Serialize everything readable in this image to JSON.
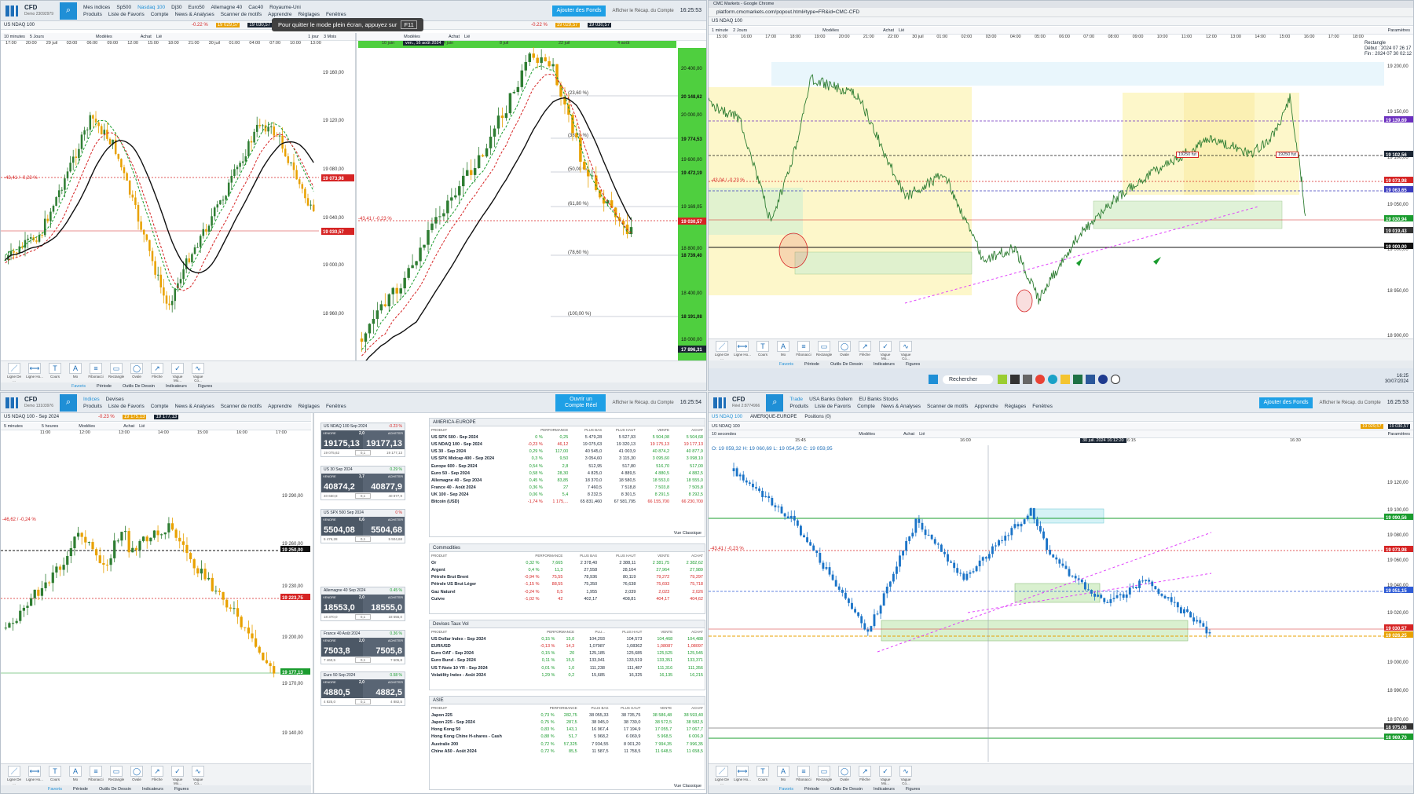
{
  "app": {
    "brand": "CFD",
    "demo_label": "Demo 23092979",
    "demo_label_2": "Demo 13103976",
    "demo_label_3": "Réel 2:8774966",
    "menu": [
      "Produits",
      "Liste de Favoris",
      "Compte",
      "News & Analyses",
      "Scanner de motifs",
      "Apprendre",
      "Réglages",
      "Fenêtres"
    ],
    "cta_funds": "Ajouter des Fonds",
    "cta_real": "Ouvrir un Compte Réel",
    "recap": "Afficher le Récap. du Compte",
    "clock": "16:25:53",
    "clock2": "16:25:54",
    "fullscreen_hint": "Pour quitter le mode plein écran, appuyez sur",
    "fullscreen_key": "F11"
  },
  "q1": {
    "tabs": [
      "Mes indices",
      "Sp500",
      "Nasdaq 100",
      "Dj30",
      "Euro50",
      "Allemagne 40",
      "Cac40",
      "Royaume-Uni"
    ],
    "instrument": "US NDAQ 100",
    "badge": "-0.22 %",
    "badge_sub": "-42.91",
    "sell": "19 029,57",
    "buy": "19 030,57",
    "timeframe_left": "10 minutes",
    "range_left": "5 Jours",
    "timeframe_mid": "1 jour",
    "range_mid": "3 Mois",
    "models": "Modèles",
    "achat": "Achat",
    "lie": "Lié",
    "y_ticks_left": [
      "19 160,00",
      "19 120,00",
      "19 080,00",
      "19 040,00",
      "19 000,00",
      "18 960,00"
    ],
    "tag_left_1": "19 073,98",
    "tag_left_2": "19 030,57",
    "change_label": "-43,41 / -0,23 %",
    "x_ticks_left": [
      "17:00",
      "20:00",
      "29 juil",
      "03:00",
      "06:00",
      "09:00",
      "12:00",
      "15:00",
      "18:00",
      "21:00",
      "30 juil",
      "01:00",
      "04:00",
      "07:00",
      "10:00",
      "13:00"
    ],
    "mid_date": "ven., 16 août 2024",
    "x_ticks_mid": [
      "10 juin",
      "24 juin",
      "8 juil",
      "22 juil",
      "4 août"
    ],
    "y_ticks_mid": [
      "20 400,00",
      "20 148,62",
      "20 000,00",
      "19 774,53",
      "19 600,00",
      "19 472,19",
      "19 169,05",
      "19 030,57",
      "18 800,00",
      "18 739,40",
      "18 400,00",
      "18 191,08",
      "18 000,00",
      "17 896,31"
    ],
    "fibs": [
      "(23,60 %)",
      "(38,20 %)",
      "(50,00 %)",
      "(61,80 %)",
      "(78,60 %)",
      "(100,00 %)"
    ],
    "bottom_tabs": [
      "Favoris",
      "Période",
      "Outils De Dessin",
      "Indicateurs",
      "Figures"
    ]
  },
  "tools": [
    {
      "icon": "line-icon",
      "label": "Ligne De ..."
    },
    {
      "icon": "hline-icon",
      "label": "Ligne Ho..."
    },
    {
      "icon": "price-icon",
      "label": "Cours"
    },
    {
      "icon": "text-icon",
      "label": "Mo"
    },
    {
      "icon": "fibonacci-icon",
      "label": "Fibonacci"
    },
    {
      "icon": "rectangle-icon",
      "label": "Rectangle"
    },
    {
      "icon": "oval-icon",
      "label": "Ovale"
    },
    {
      "icon": "arrow-icon",
      "label": "Flèche"
    },
    {
      "icon": "wave-icon",
      "label": "Vague Mo..."
    },
    {
      "icon": "wave2-icon",
      "label": "Vague Co..."
    }
  ],
  "q2": {
    "browser_title": "CMC Markets - Google Chrome",
    "url": "platform.cmcmarkets.com/popout.html#type=FR&id=CMC-CFD",
    "instrument": "US NDAQ 100",
    "timeframe": "1 minute",
    "range": "2 Jours",
    "params": "Paramètres",
    "info_title": "Rectangle",
    "info_start": "Début : 2024 07 26 17",
    "info_end": "Fin : 2024 07 30 02:12",
    "x_ticks": [
      "15:00",
      "16:00",
      "17:00",
      "18:00",
      "19:00",
      "20:00",
      "21:00",
      "22:00",
      "30 juil",
      "01:00",
      "02:00",
      "03:00",
      "04:00",
      "05:00",
      "06:00",
      "07:00",
      "08:00",
      "09:00",
      "10:00",
      "11:00",
      "12:00",
      "13:00",
      "14:00",
      "15:00",
      "16:00",
      "17:00",
      "18:00"
    ],
    "y_ticks": [
      "19 200,00",
      "19 150,00",
      "19 100,00",
      "19 050,00",
      "19 000,00",
      "18 950,00",
      "18 900,00"
    ],
    "tags": [
      {
        "v": "19 139,69",
        "c": "#6b2fbf"
      },
      {
        "v": "19 102,56",
        "c": "#1a2533"
      },
      {
        "v": "19 073,98",
        "c": "#d62424"
      },
      {
        "v": "19 063,65",
        "c": "#3b3bbf"
      },
      {
        "v": "19 030,94",
        "c": "#1a9c2e"
      },
      {
        "v": "19 019,43",
        "c": "#333333"
      },
      {
        "v": "19 000,00",
        "c": "#111111"
      }
    ],
    "flag1": "19250 fut",
    "flag2": "19250 fut",
    "change_label": "-43,04 / -0,23 %",
    "taskbar_search": "Rechercher",
    "taskbar_time": "16:25",
    "taskbar_date": "30/07/2024"
  },
  "q3": {
    "tabs": [
      "Indices",
      "Devises"
    ],
    "instrument": "US NDAQ 100 - Sep 2024",
    "badge": "-0.23 %",
    "sell": "19 175,13",
    "buy": "19 177,13",
    "timeframe": "5 minutes",
    "range": "5 heures",
    "x_ticks": [
      "11:00",
      "12:00",
      "13:00",
      "14:00",
      "15:00",
      "16:00",
      "17:00"
    ],
    "y_ticks": [
      "19 290,00",
      "19 260,00",
      "19 230,00",
      "19 200,00",
      "19 170,00",
      "19 140,00"
    ],
    "tag_1": "19 250,00",
    "tag_2": "19 223,75",
    "tag_3": "19 177,13",
    "change_label": "-46,62 / -0,24 %"
  },
  "tickets": [
    {
      "name": "US NDAQ 100 Sep 2024",
      "chg": "-0.23 %",
      "sell": "19175,13",
      "buy": "19177,13",
      "spread": "2,0",
      "lo": "19 075,62",
      "qty": "0,1",
      "hi": "19 177,13"
    },
    {
      "name": "US 30 Sep 2024",
      "chg": "0.29 %",
      "sell": "40874,2",
      "buy": "40877,9",
      "spread": "3,7",
      "lo": "40 650,8",
      "qty": "0,1",
      "hi": "40 877,9"
    },
    {
      "name": "US SPX 500 Sep 2024",
      "chg": "0 %",
      "sell": "5504,08",
      "buy": "5504,68",
      "spread": "0,6",
      "lo": "5 476,28",
      "qty": "0,1",
      "hi": "5 504,68"
    },
    {
      "name": "Allemagne 40 Sep 2024",
      "chg": "0.45 %",
      "sell": "18553,0",
      "buy": "18555,0",
      "spread": "2,0",
      "lo": "18 370,0",
      "qty": "0,1",
      "hi": "18 555,0"
    },
    {
      "name": "France 40 Août 2024",
      "chg": "0.36 %",
      "sell": "7503,8",
      "buy": "7505,8",
      "spread": "2,0",
      "lo": "7 460,5",
      "qty": "0,1",
      "hi": "7 505,8"
    },
    {
      "name": "Euro 50 Sep 2024",
      "chg": "0.58 %",
      "sell": "4880,5",
      "buy": "4882,5",
      "spread": "2,0",
      "lo": "4 825,0",
      "qty": "0,1",
      "hi": "4 882,5"
    }
  ],
  "lists": [
    {
      "title": "AMERICA-EUROPE",
      "cols": [
        "PRODUIT",
        "PERFORMANCE",
        "PLUS BAS",
        "PLUS HAUT",
        "VENTE",
        "ACHAT"
      ],
      "rows": [
        [
          "US SPX 500 - Sep 2024",
          "0 %",
          "0,25",
          "5 479,28",
          "5 527,93",
          "5 504,08",
          "5 504,68"
        ],
        [
          "US NDAQ 100 - Sep 2024",
          "-0,23 %",
          "46,12",
          "19 075,63",
          "19 320,13",
          "19 175,13",
          "19 177,13"
        ],
        [
          "US 30 - Sep 2024",
          "0,29 %",
          "117,00",
          "40 545,0",
          "41 003,9",
          "40 874,2",
          "40 877,9"
        ],
        [
          "US SPX Midcap 400 - Sep 2024",
          "0,3 %",
          "9,50",
          "3 054,60",
          "3 115,30",
          "3 095,60",
          "3 098,10"
        ],
        [
          "Europe 600 - Sep 2024",
          "0,54 %",
          "2,8",
          "512,95",
          "517,80",
          "516,70",
          "517,00"
        ],
        [
          "Euro 50 - Sep 2024",
          "0,58 %",
          "28,30",
          "4 825,0",
          "4 889,5",
          "4 880,5",
          "4 882,5"
        ],
        [
          "Allemagne 40 - Sep 2024",
          "0,45 %",
          "83,85",
          "18 370,0",
          "18 580,5",
          "18 553,0",
          "18 555,0"
        ],
        [
          "France 40 - Août 2024",
          "0,36 %",
          "27",
          "7 460,5",
          "7 518,8",
          "7 503,8",
          "7 505,8"
        ],
        [
          "UK 100 - Sep 2024",
          "0,06 %",
          "5,4",
          "8 232,5",
          "8 301,5",
          "8 291,5",
          "8 292,5"
        ],
        [
          "Bitcoin (USD)",
          "-1,74 %",
          "1 175,...",
          "65 831,460",
          "67 581,795",
          "66 155,700",
          "66 230,700"
        ]
      ],
      "footer": "Vue Classique"
    },
    {
      "title": "Commodities",
      "cols": [
        "PRODUIT",
        "PERFORMANCE",
        "PLUS BAS",
        "PLUS HAUT",
        "VENTE",
        "ACHAT"
      ],
      "rows": [
        [
          "Or",
          "0,32 %",
          "7,665",
          "2 378,40",
          "2 388,11",
          "2 381,75",
          "2 382,62"
        ],
        [
          "Argent",
          "0,4 %",
          "11,3",
          "27,558",
          "28,104",
          "27,964",
          "27,989"
        ],
        [
          "Pétrole Brut Brent",
          "-0,94 %",
          "75,55",
          "78,936",
          "80,119",
          "79,272",
          "79,297"
        ],
        [
          "Pétrole US Brut Léger",
          "-1,15 %",
          "88,55",
          "75,350",
          "76,638",
          "75,693",
          "75,718"
        ],
        [
          "Gaz Naturel",
          "-0,24 %",
          "0,5",
          "1,955",
          "2,039",
          "2,023",
          "2,026"
        ],
        [
          "Cuivre",
          "-1,02 %",
          "42",
          "402,17",
          "408,81",
          "404,17",
          "404,62"
        ]
      ],
      "footer": ""
    },
    {
      "title": "Devises Taux Vol",
      "cols": [
        "PRODUIT",
        "PERFORMANCE",
        "PLU...",
        "PLUS HAUT",
        "VENTE",
        "ACHAT"
      ],
      "rows": [
        [
          "US Dollar Index - Sep 2024",
          "0,15 %",
          "15,0",
          "104,293",
          "104,573",
          "104,468",
          "104,488"
        ],
        [
          "EUR/USD",
          "-0,13 %",
          "14,3",
          "1,07987",
          "1,08362",
          "1,08087",
          "1,08097"
        ],
        [
          "Euro OAT - Sep 2024",
          "0,15 %",
          "20",
          "125,185",
          "125,685",
          "125,525",
          "125,545"
        ],
        [
          "Euro Bund - Sep 2024",
          "0,11 %",
          "15,5",
          "133,041",
          "133,519",
          "133,351",
          "133,371"
        ],
        [
          "US T-Note 10 YR - Sep 2024",
          "0,01 %",
          "1,0",
          "111,238",
          "111,487",
          "111,316",
          "111,356"
        ],
        [
          "Volatility Index - Août 2024",
          "1,29 %",
          "0,2",
          "15,685",
          "16,325",
          "16,135",
          "16,215"
        ]
      ],
      "footer": ""
    },
    {
      "title": "ASIE",
      "cols": [
        "PRODUIT",
        "PERFORMANCE",
        "PLUS BAS",
        "PLUS HAUT",
        "VENTE",
        "ACHAT"
      ],
      "rows": [
        [
          "Japon 225",
          "0,73 %",
          "282,75",
          "38 055,33",
          "38 735,75",
          "38 586,48",
          "38 593,40"
        ],
        [
          "Japon 225 - Sep 2024",
          "0,75 %",
          "287,5",
          "38 045,0",
          "38 730,0",
          "38 572,5",
          "38 582,5"
        ],
        [
          "Hong Kong 50",
          "0,83 %",
          "143,1",
          "16 967,4",
          "17 194,9",
          "17 055,7",
          "17 067,7"
        ],
        [
          "Hong Kong Chine H-shares - Cash",
          "0,88 %",
          "51,7",
          "5 968,2",
          "6 069,9",
          "5 968,5",
          "6 006,9"
        ],
        [
          "Australie 200",
          "0,72 %",
          "57,325",
          "7 934,55",
          "8 001,20",
          "7 994,35",
          "7 996,35"
        ],
        [
          "Chine A50 - Août 2024",
          "0,72 %",
          "85,5",
          "11 587,5",
          "11 758,5",
          "11 648,5",
          "11 658,5"
        ]
      ],
      "footer": "Vue Classique"
    }
  ],
  "q4": {
    "tabs": [
      "Trade",
      "USA Banks Gollem",
      "EU Banks Stocks"
    ],
    "subtabs": [
      "US NDAQ 100",
      "AMERIQUE-EUROPE",
      "Positions (0)"
    ],
    "instrument": "US NDAQ 100",
    "timeframe": "10 secondes",
    "ohlc": "O: 19 059,32   H: 19 060,69   L: 19 054,50   C: 19 059,95",
    "date_label": "30 juil. 2024 16:12:20",
    "x_ticks": [
      "15:45",
      "16:00",
      "16:15",
      "16:30"
    ],
    "y_ticks": [
      "19 120,00",
      "19 100,00",
      "19 080,00",
      "19 060,00",
      "19 040,00",
      "19 020,00",
      "19 000,00",
      "18 990,00",
      "18 970,00"
    ],
    "tags": [
      {
        "v": "19 090,56",
        "c": "#1a9c2e"
      },
      {
        "v": "19 073,98",
        "c": "#d62424"
      },
      {
        "v": "19 051,15",
        "c": "#2e5bd6"
      },
      {
        "v": "19 030,57",
        "c": "#d62424"
      },
      {
        "v": "19 026,25",
        "c": "#e8a100"
      },
      {
        "v": "18 975,08",
        "c": "#333333"
      },
      {
        "v": "18 969,70",
        "c": "#1a9c2e"
      }
    ],
    "change_label": "-43,41 / -0,23 %"
  }
}
